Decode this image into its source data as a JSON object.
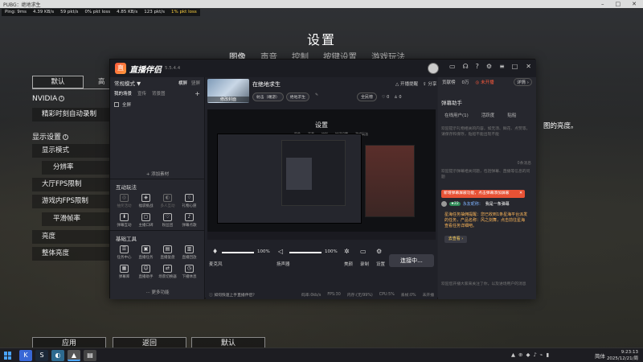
{
  "window": {
    "title": "PUBG：绝地求生",
    "controls": [
      "–",
      "□",
      "✕"
    ]
  },
  "netstats": {
    "ping": "Ping: 9ms",
    "in_rate": "4.39 KB/s",
    "in_pkt": "59 pkt/s",
    "in_loss": "0% pkt loss",
    "out_rate": "4.85 KB/s",
    "out_pkt": "123 pkt/s",
    "out_loss": "1% pkt loss"
  },
  "game": {
    "title": "设置",
    "tabs": [
      "图像",
      "声音",
      "控制",
      "按键设置",
      "游戏玩法"
    ],
    "left_tabs": [
      "默认",
      "高"
    ],
    "nvidia_label": "NVIDIA",
    "nvidia_row": "精彩时刻自动录制",
    "display_section": "显示设置",
    "rows": [
      "显示模式",
      "分辨率",
      "大厅FPS限制",
      "游戏内FPS限制",
      "平滑帧率",
      "亮度",
      "整体亮度"
    ],
    "brightness_hint": "图的亮度。",
    "buttons": {
      "apply": "应用",
      "back": "返回",
      "default": "默认"
    }
  },
  "app": {
    "logo_mark": "直",
    "name": "直播伴侣",
    "version": "5.5.4.4",
    "header_icons": [
      "▭",
      "☊",
      "?",
      "⚙",
      "≡"
    ],
    "window_ctrls": [
      "–",
      "□",
      "✕"
    ],
    "mode_label": "常规模式 ▼",
    "mode_switch": {
      "active": "横屏",
      "inactive": "竖屏"
    },
    "scene_tabs": [
      "我的场景",
      "宣传",
      "背景图"
    ],
    "scene_item": "全屏",
    "add_material": "+ 添加素材",
    "interact_title": "互动玩法",
    "interact_items": [
      {
        "label": "抽奖活动",
        "icon": "◎",
        "dim": true
      },
      {
        "label": "福袋挑战",
        "icon": "◈",
        "dim": false
      },
      {
        "label": "多人互动",
        "icon": "◐",
        "dim": true
      },
      {
        "label": "礼物心愿",
        "icon": "♢",
        "dim": false
      },
      {
        "label": "弹幕互动",
        "icon": "⬇",
        "dim": false
      },
      {
        "label": "主播口碑",
        "icon": "▢",
        "dim": false
      },
      {
        "label": "粉丝团",
        "icon": "♡",
        "dim": false
      },
      {
        "label": "弹幕点歌",
        "icon": "♪",
        "dim": false
      }
    ],
    "tools_title": "基础工具",
    "tools_items": [
      {
        "label": "任务中心",
        "icon": "☰",
        "dim": false
      },
      {
        "label": "直播任务",
        "icon": "▣",
        "dim": false
      },
      {
        "label": "直播复盘",
        "icon": "▤",
        "dim": false
      },
      {
        "label": "直播回放",
        "icon": "▥",
        "dim": false
      },
      {
        "label": "弹幕库",
        "icon": "▦",
        "dim": false
      },
      {
        "label": "直播助手",
        "icon": "☺",
        "dim": false
      },
      {
        "label": "场景切换器",
        "icon": "⇄",
        "dim": false
      },
      {
        "label": "下播休息",
        "icon": "◷",
        "dim": false
      }
    ],
    "more_functions": "··· 更多功能",
    "stream": {
      "cover_label": "修改封面",
      "title": "在绝地求生",
      "tags": [
        "射击（端游）",
        "绝地求生"
      ],
      "edit": "✎",
      "right_top": [
        "△ 开播提醒",
        "⇪ 分享"
      ],
      "right_bottom": [
        "全民榜",
        "♡ 0",
        "♙ 0"
      ],
      "preview_title": "设置",
      "preview_tabs": [
        "图像",
        "声音",
        "控制",
        "按键设置",
        "游戏玩法"
      ]
    },
    "controls": {
      "mic_label": "麦克风",
      "mic_value": "100%",
      "mic_level": 1.0,
      "speaker_label": "扬声器",
      "speaker_value": "100%",
      "speaker_level": 1.0,
      "beauty": "美颜",
      "record": "录制",
      "settings": "设置",
      "start": "连接中..."
    },
    "statusbar": [
      "ⓘ 如何快速上手直播伴侣？",
      "码率:0kb/s",
      "FPS:30",
      "内存:(无/99%)",
      "CPU:5%",
      "丢帧:0%",
      "未开播"
    ],
    "right": {
      "tabs_top": [
        "贡献榜",
        "0万"
      ],
      "hot": "◎ 未开播",
      "detail": "详情 ›",
      "section": "弹幕助手",
      "subtabs": [
        "在线用户(1)",
        "活跃度",
        "贴船"
      ],
      "gray1": "欢迎提示礼物相关的内容，如无须、鲜花、点赞等，请保存和保存，贴船不能出现不能",
      "gray2": "0条消息",
      "gray3": "欢迎提示弹幕相关问题，包括弹幕、直播等信息的问题",
      "note": "新增弹幕屏蔽功能，点击弹幕添加屏蔽",
      "note_close": "✕",
      "user_level": "★22",
      "user_name": "永友昵称：",
      "user_msg": "我是一条弹幕",
      "tip": "星海任务抽佣提醒：您已收到1条星海平台派发的任务，产品名称：风之剑舞，点击前往星海查看任务详细吧。",
      "go": "去查看 ›",
      "gray4": "欢迎您开播大家来关注了你，以及进场用户的消息"
    }
  },
  "taskbar": {
    "apps": [
      "K",
      "S",
      "◐",
      "▲",
      "▤"
    ],
    "tray_icons": [
      "▲",
      "⊕",
      "◆",
      "♪",
      "⌁",
      "▮"
    ],
    "lang": "简体",
    "time": "9:23:13",
    "date": "2025/12/21/周日"
  },
  "colors": {
    "accent": "#ff5a3c",
    "note_bg": "#e85235",
    "windows_blue": "#4aa3ff"
  }
}
